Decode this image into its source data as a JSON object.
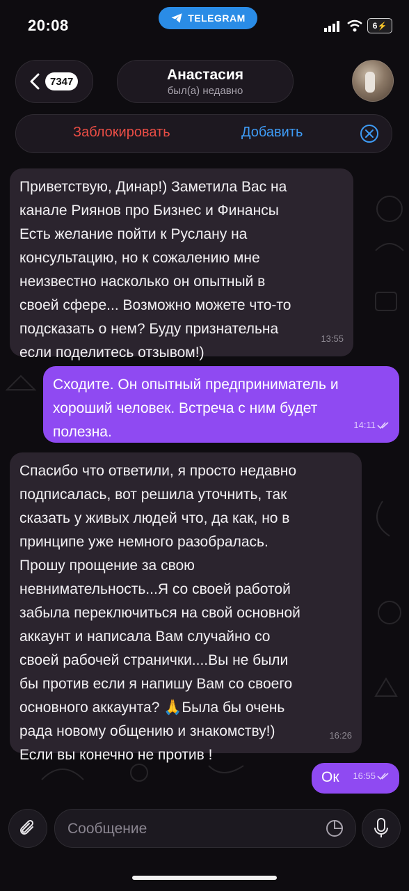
{
  "status_bar": {
    "time": "20:08",
    "app_pill": "TELEGRAM",
    "battery": "6"
  },
  "header": {
    "back_count": "7347",
    "contact_name": "Анастасия",
    "contact_status": "был(а) недавно"
  },
  "actions": {
    "block_label": "Заблокировать",
    "add_label": "Добавить"
  },
  "messages": [
    {
      "direction": "incoming",
      "text": "Приветствую, Динар!) Заметила Вас на\nканале Риянов про Бизнес и Финансы\nЕсть желание пойти к Руслану на\nконсультацию, но к сожалению мне\nнеизвестно насколько он опытный в\nсвоей сфере... Возможно можете что-то\nподсказать о нем? Буду признательна\nесли поделитесь отзывом!)",
      "time": "13:55"
    },
    {
      "direction": "outgoing",
      "text": "Сходите. Он опытный предприниматель и\nхороший человек. Встреча с ним будет\nполезна.",
      "time": "14:11"
    },
    {
      "direction": "incoming",
      "text": "Спасибо что ответили, я просто недавно\nподписалась, вот решила уточнить, так\nсказать у живых людей что, да как, но в\nпринципе уже немного разобралась.\nПрошу прощение за свою\nневнимательность...Я со своей работой\nзабыла переключиться на свой основной\nаккаунт и написала Вам случайно со\nсвоей рабочей странички....Вы не были\nбы против если я напишу Вам со своего\nосновного аккаунта? 🙏Была бы очень\nрада новому общению и знакомству!)\nЕсли вы конечно не против !",
      "time": "16:26"
    },
    {
      "direction": "outgoing",
      "text": "Ок",
      "time": "16:55"
    }
  ],
  "composer": {
    "placeholder": "Сообщение"
  },
  "colors": {
    "accent": "#8f4af2",
    "incoming_bubble": "#2b242e",
    "block_red": "#ea4d45",
    "link_blue": "#3e9bf5",
    "telegram_blue": "#2a8ce6"
  },
  "icons": {
    "back": "chevron-left-icon",
    "close": "close-circle-icon",
    "attach": "paperclip-icon",
    "sticker": "sticker-icon",
    "mic": "microphone-icon",
    "read": "double-check-icon"
  }
}
